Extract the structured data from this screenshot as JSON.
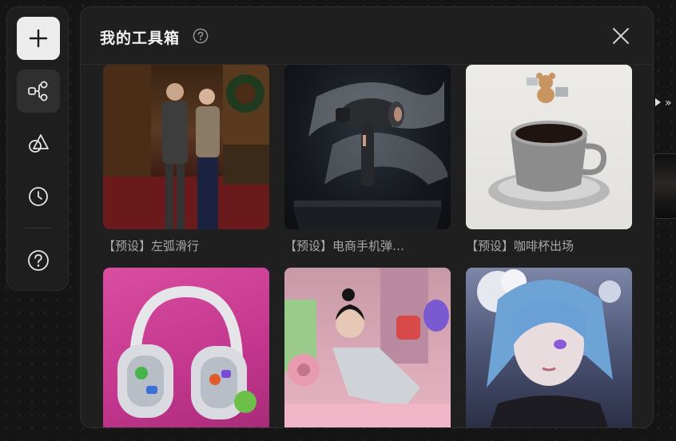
{
  "toolbar": {
    "items": [
      {
        "name": "add",
        "icon": "plus-icon"
      },
      {
        "name": "workflow",
        "icon": "workflow-icon"
      },
      {
        "name": "shapes",
        "icon": "shapes-icon"
      },
      {
        "name": "history",
        "icon": "clock-icon"
      },
      {
        "name": "help",
        "icon": "question-icon"
      }
    ]
  },
  "panel": {
    "title": "我的工具箱",
    "help_icon": "question-circle-icon",
    "close_icon": "close-icon",
    "cards": [
      {
        "label": "【预设】左弧滑行",
        "image": "couple-fashion-photo"
      },
      {
        "label": "【预设】电商手机弹…",
        "image": "hair-dryer-product-photo"
      },
      {
        "label": "【预设】咖啡杯出场",
        "image": "coffee-cup-photo"
      },
      {
        "label": "",
        "image": "headphones-product-photo"
      },
      {
        "label": "",
        "image": "girl-lying-fashion-photo"
      },
      {
        "label": "",
        "image": "blue-hair-character-art"
      }
    ]
  },
  "colors": {
    "background": "#151515",
    "panel": "#1f1f1f",
    "toolbar": "#1e1e1e",
    "add_button": "#ececec",
    "label_text": "#a8a8a8"
  }
}
